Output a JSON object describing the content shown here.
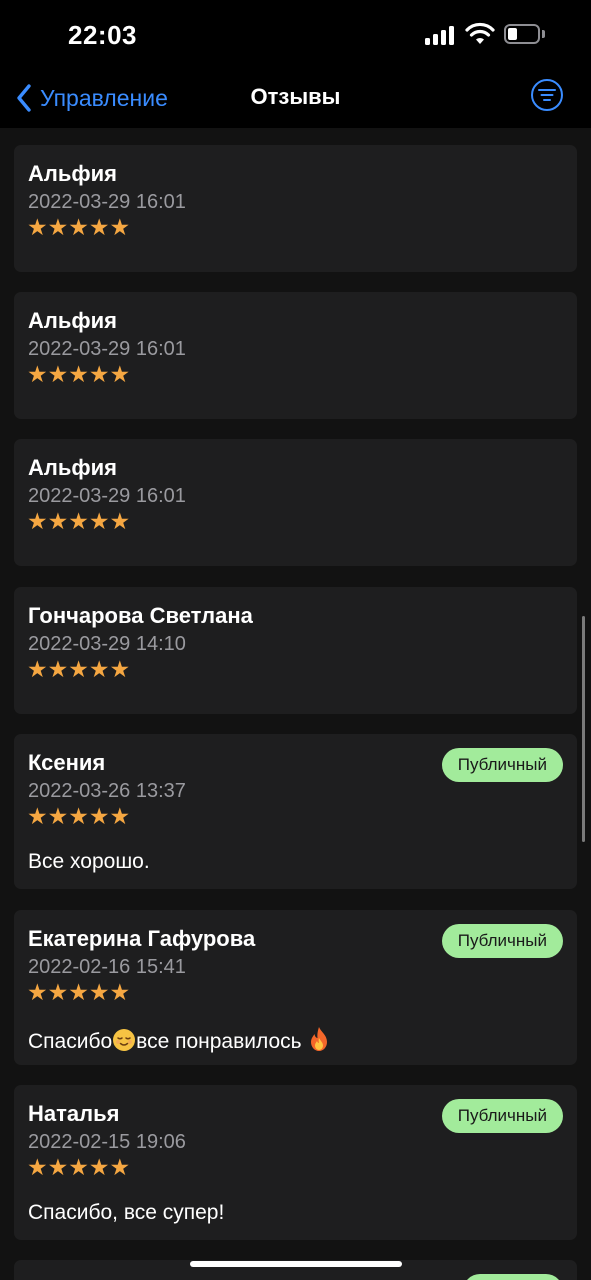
{
  "status_bar": {
    "time": "22:03"
  },
  "nav": {
    "back_label": "Управление",
    "title": "Отзывы"
  },
  "reviews": [
    {
      "name": "Альфия",
      "date": "2022-03-29 16:01",
      "rating": 5,
      "stars": "★★★★★",
      "badge": "",
      "text": ""
    },
    {
      "name": "Альфия",
      "date": "2022-03-29 16:01",
      "rating": 5,
      "stars": "★★★★★",
      "badge": "",
      "text": ""
    },
    {
      "name": "Альфия",
      "date": "2022-03-29 16:01",
      "rating": 5,
      "stars": "★★★★★",
      "badge": "",
      "text": ""
    },
    {
      "name": "Гончарова Светлана",
      "date": "2022-03-29 14:10",
      "rating": 5,
      "stars": "★★★★★",
      "badge": "",
      "text": ""
    },
    {
      "name": "Ксения",
      "date": "2022-03-26 13:37",
      "rating": 5,
      "stars": "★★★★★",
      "badge": "Публичный",
      "text": "Все хорошо."
    },
    {
      "name": "Екатерина Гафурова",
      "date": "2022-02-16 15:41",
      "rating": 5,
      "stars": "★★★★★",
      "badge": "Публичный",
      "text_before": "Спасибо",
      "text_after": "все понравилось "
    },
    {
      "name": "Наталья",
      "date": "2022-02-15 19:06",
      "rating": 5,
      "stars": "★★★★★",
      "badge": "Публичный",
      "text": "Спасибо, все супер!"
    }
  ],
  "colors": {
    "accent": "#3a8cff",
    "star": "#f5a742",
    "badge_bg": "#a2eb9b",
    "card_bg": "#1e1e1f"
  }
}
